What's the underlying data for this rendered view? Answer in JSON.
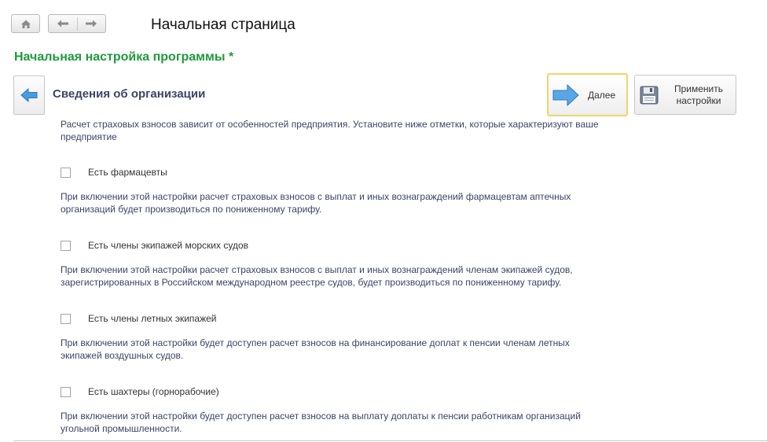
{
  "header": {
    "page_title": "Начальная страница"
  },
  "form": {
    "title": "Начальная настройка программы *",
    "section_title": "Сведения об организации",
    "next_label": "Далее",
    "apply_label_line1": "Применить",
    "apply_label_line2": "настройки",
    "intro_line1": "Расчет страховых взносов зависит от особенностей предприятия. Установите ниже отметки, которые характеризуют ваше",
    "intro_line2": "предприятие"
  },
  "options": [
    {
      "label": "Есть фармацевты",
      "checked": false,
      "hint_line1": "При включении этой настройки расчет страховых взносов с выплат и иных вознаграждений фармацевтам аптечных",
      "hint_line2": "организаций будет производиться по пониженному тарифу."
    },
    {
      "label": "Есть члены экипажей морских судов",
      "checked": false,
      "hint_line1": "При включении этой настройки расчет страховых взносов с выплат и иных вознаграждений членам экипажей судов,",
      "hint_line2": "зарегистрированных в Российском международном реестре судов, будет производиться по пониженному тарифу."
    },
    {
      "label": "Есть члены летных экипажей",
      "checked": false,
      "hint_line1": "При включении этой настройки будет доступен расчет взносов на финансирование доплат к пенсии членам летных",
      "hint_line2": "экипажей воздушных судов."
    },
    {
      "label": "Есть шахтеры (горнорабочие)",
      "checked": false,
      "hint_line1": "При включении этой настройки будет доступен расчет взносов на выплату доплаты к пенсии работникам организаций",
      "hint_line2": "угольной промышленности."
    }
  ],
  "icons": {
    "home": "home-icon",
    "back": "arrow-left-icon",
    "forward": "arrow-right-icon",
    "next": "arrow-right-icon",
    "save": "floppy-disk-icon"
  },
  "colors": {
    "form_title": "#1f9a3c",
    "section_title": "#3b4566",
    "hint_text": "#3b4566",
    "next_button_border": "#f0d46a",
    "arrow_blue": "#3a8fd4"
  }
}
